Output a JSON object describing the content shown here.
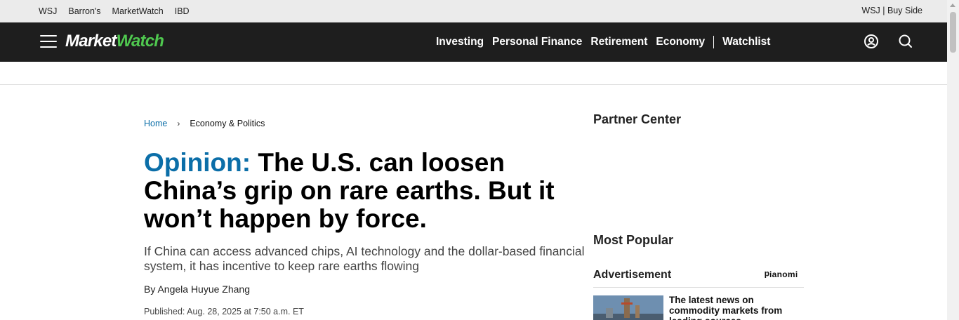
{
  "utility": {
    "links": [
      "WSJ",
      "Barron's",
      "MarketWatch",
      "IBD"
    ],
    "right_text": "WSJ | Buy Side"
  },
  "nav": {
    "logo_part1": "Market",
    "logo_part2": "Watch",
    "menu": [
      "Investing",
      "Personal Finance",
      "Retirement",
      "Economy"
    ],
    "watchlist": "Watchlist",
    "icons": [
      "menu-icon",
      "user-icon",
      "search-icon"
    ]
  },
  "breadcrumb": {
    "home": "Home",
    "section": "Economy & Politics"
  },
  "article": {
    "label": "Opinion:",
    "headline": "The U.S. can loosen China’s grip on rare earths. But it won’t happen by force.",
    "dek": "If China can access advanced chips, AI technology and the dollar-based financial system, it has incentive to keep rare earths flowing",
    "byline": "By Angela Huyue Zhang",
    "published": "Published: Aug. 28, 2025 at 7:50 a.m. ET"
  },
  "sidebar": {
    "partner_center": "Partner Center",
    "most_popular": "Most Popular",
    "advertisement": "Advertisement",
    "ad_network": "Dianomi",
    "ad_headline": "The latest news on commodity markets from leading sources"
  },
  "colors": {
    "nav_bg": "#1e1e1e",
    "logo_accent": "#4fc84f",
    "opinion_blue": "#0b6ea8"
  }
}
